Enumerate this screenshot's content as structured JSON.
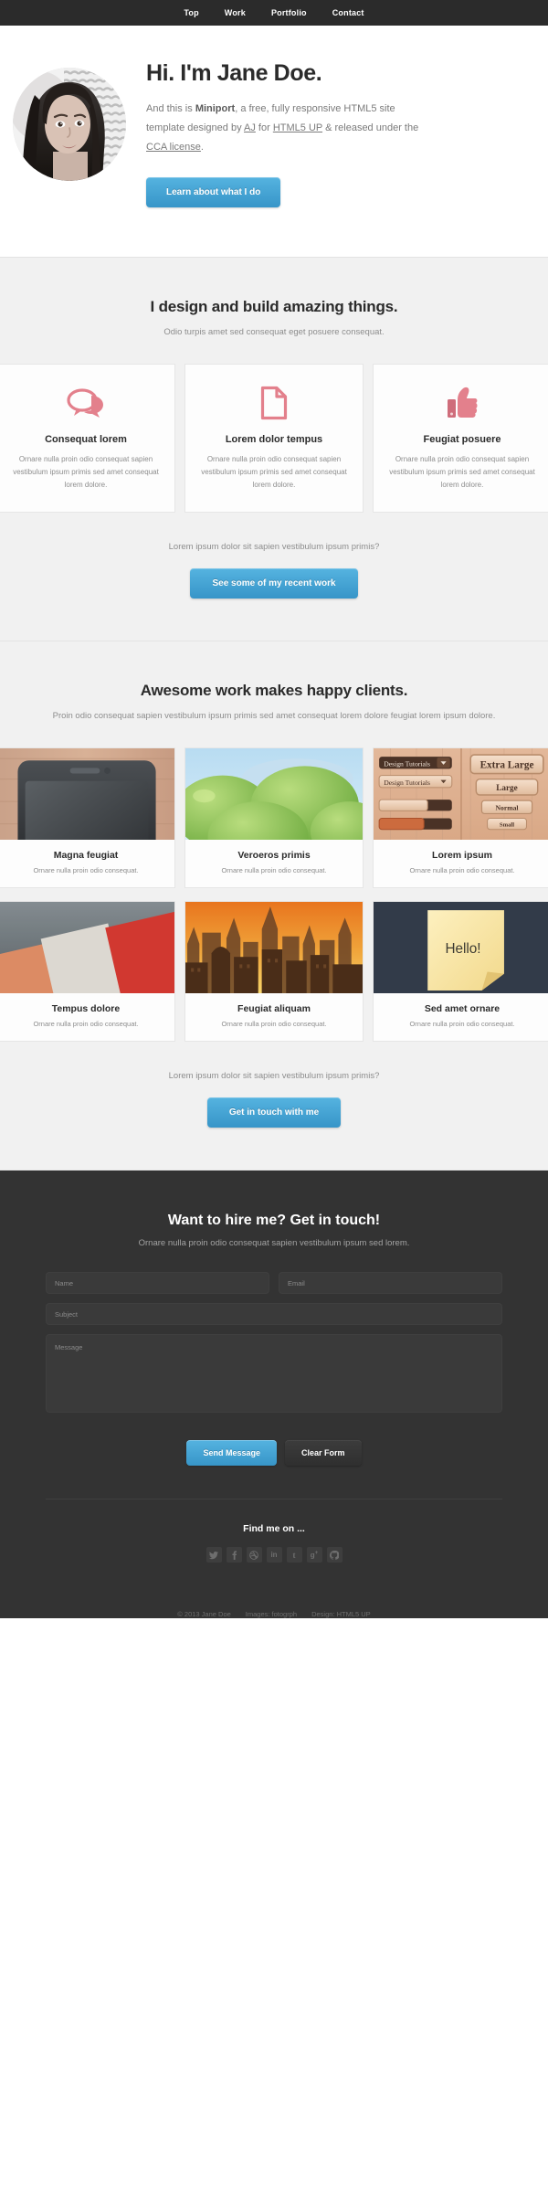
{
  "nav": {
    "items": [
      {
        "label": "Top",
        "name": "nav-link-top"
      },
      {
        "label": "Work",
        "name": "nav-link-work"
      },
      {
        "label": "Portfolio",
        "name": "nav-link-portfolio"
      },
      {
        "label": "Contact",
        "name": "nav-link-contact"
      }
    ]
  },
  "hero": {
    "avatar_alt": "portrait-photo",
    "title": "Hi. I'm Jane Doe.",
    "intro_1": "And this is ",
    "intro_brand": "Miniport",
    "intro_2": ", a free, fully responsive HTML5 site template designed by ",
    "link_aj": "AJ",
    "intro_3": " for ",
    "link_h5up": "HTML5 UP",
    "intro_4": " & released under the ",
    "link_cca": "CCA license",
    "intro_5": ".",
    "button": "Learn about what I do"
  },
  "work": {
    "heading": "I design and build amazing things.",
    "subheading": "Odio turpis amet sed consequat eget posuere consequat.",
    "features": [
      {
        "icon": "speech-bubbles-icon",
        "title": "Consequat lorem",
        "text": "Ornare nulla proin odio consequat sapien vestibulum ipsum primis sed amet consequat lorem dolore."
      },
      {
        "icon": "document-icon",
        "title": "Lorem dolor tempus",
        "text": "Ornare nulla proin odio consequat sapien vestibulum ipsum primis sed amet consequat lorem dolore."
      },
      {
        "icon": "thumbs-up-icon",
        "title": "Feugiat posuere",
        "text": "Ornare nulla proin odio consequat sapien vestibulum ipsum primis sed amet consequat lorem dolore."
      }
    ],
    "cta_text": "Lorem ipsum dolor sit sapien vestibulum ipsum primis?",
    "cta_button": "See some of my recent work"
  },
  "portfolio": {
    "heading": "Awesome work makes happy clients.",
    "subheading": "Proin odio consequat sapien vestibulum ipsum primis sed amet consequat lorem dolore feugiat lorem ipsum dolore.",
    "items": [
      {
        "thumb": "smartphone-on-wood-thumb",
        "title": "Magna feugiat",
        "text": "Ornare nulla proin odio consequat."
      },
      {
        "thumb": "green-apples-thumb",
        "title": "Veroeros primis",
        "text": "Ornare nulla proin odio consequat."
      },
      {
        "thumb": "wooden-ui-kit-thumb",
        "title": "Lorem ipsum",
        "text": "Ornare nulla proin odio consequat."
      },
      {
        "thumb": "paper-textures-thumb",
        "title": "Tempus dolore",
        "text": "Ornare nulla proin odio consequat."
      },
      {
        "thumb": "city-skyline-thumb",
        "title": "Feugiat aliquam",
        "text": "Ornare nulla proin odio consequat."
      },
      {
        "thumb": "sticky-note-thumb",
        "title": "Sed amet ornare",
        "text": "Ornare nulla proin odio consequat."
      }
    ],
    "ui_kit_labels": {
      "select_1": "Design Tutorials",
      "select_2": "Design Tutorials",
      "btn_xl": "Extra Large",
      "btn_l": "Large",
      "btn_n": "Normal",
      "btn_s": "Small"
    },
    "sticky_note_text": "Hello!",
    "cta_text": "Lorem ipsum dolor sit sapien vestibulum ipsum primis?",
    "cta_button": "Get in touch with me"
  },
  "contact": {
    "heading": "Want to hire me? Get in touch!",
    "subheading": "Ornare nulla proin odio consequat sapien vestibulum ipsum sed lorem.",
    "fields": {
      "name_placeholder": "Name",
      "name_value": "",
      "email_placeholder": "Email",
      "email_value": "",
      "subject_placeholder": "Subject",
      "subject_value": "",
      "message_placeholder": "Message",
      "message_value": ""
    },
    "send_button": "Send Message",
    "clear_button": "Clear Form"
  },
  "social": {
    "heading": "Find me on ...",
    "items": [
      {
        "name": "twitter-icon",
        "glyph": "t"
      },
      {
        "name": "facebook-icon",
        "glyph": "f"
      },
      {
        "name": "dribbble-icon",
        "glyph": "d"
      },
      {
        "name": "linkedin-icon",
        "glyph": "in"
      },
      {
        "name": "tumblr-icon",
        "glyph": "t"
      },
      {
        "name": "google-plus-icon",
        "glyph": "g+"
      },
      {
        "name": "github-icon",
        "glyph": "gh"
      }
    ]
  },
  "footer": {
    "copyright": "© 2013 Jane Doe",
    "images_label": "Images: fotogrph",
    "design_label": "Design: HTML5 UP"
  },
  "colors": {
    "nav_bg": "#2b2b2b",
    "accent_blue": "#3795c8",
    "accent_pink": "#e3808c",
    "dark_bg": "#333333",
    "grey_bg": "#f1f1f1"
  }
}
